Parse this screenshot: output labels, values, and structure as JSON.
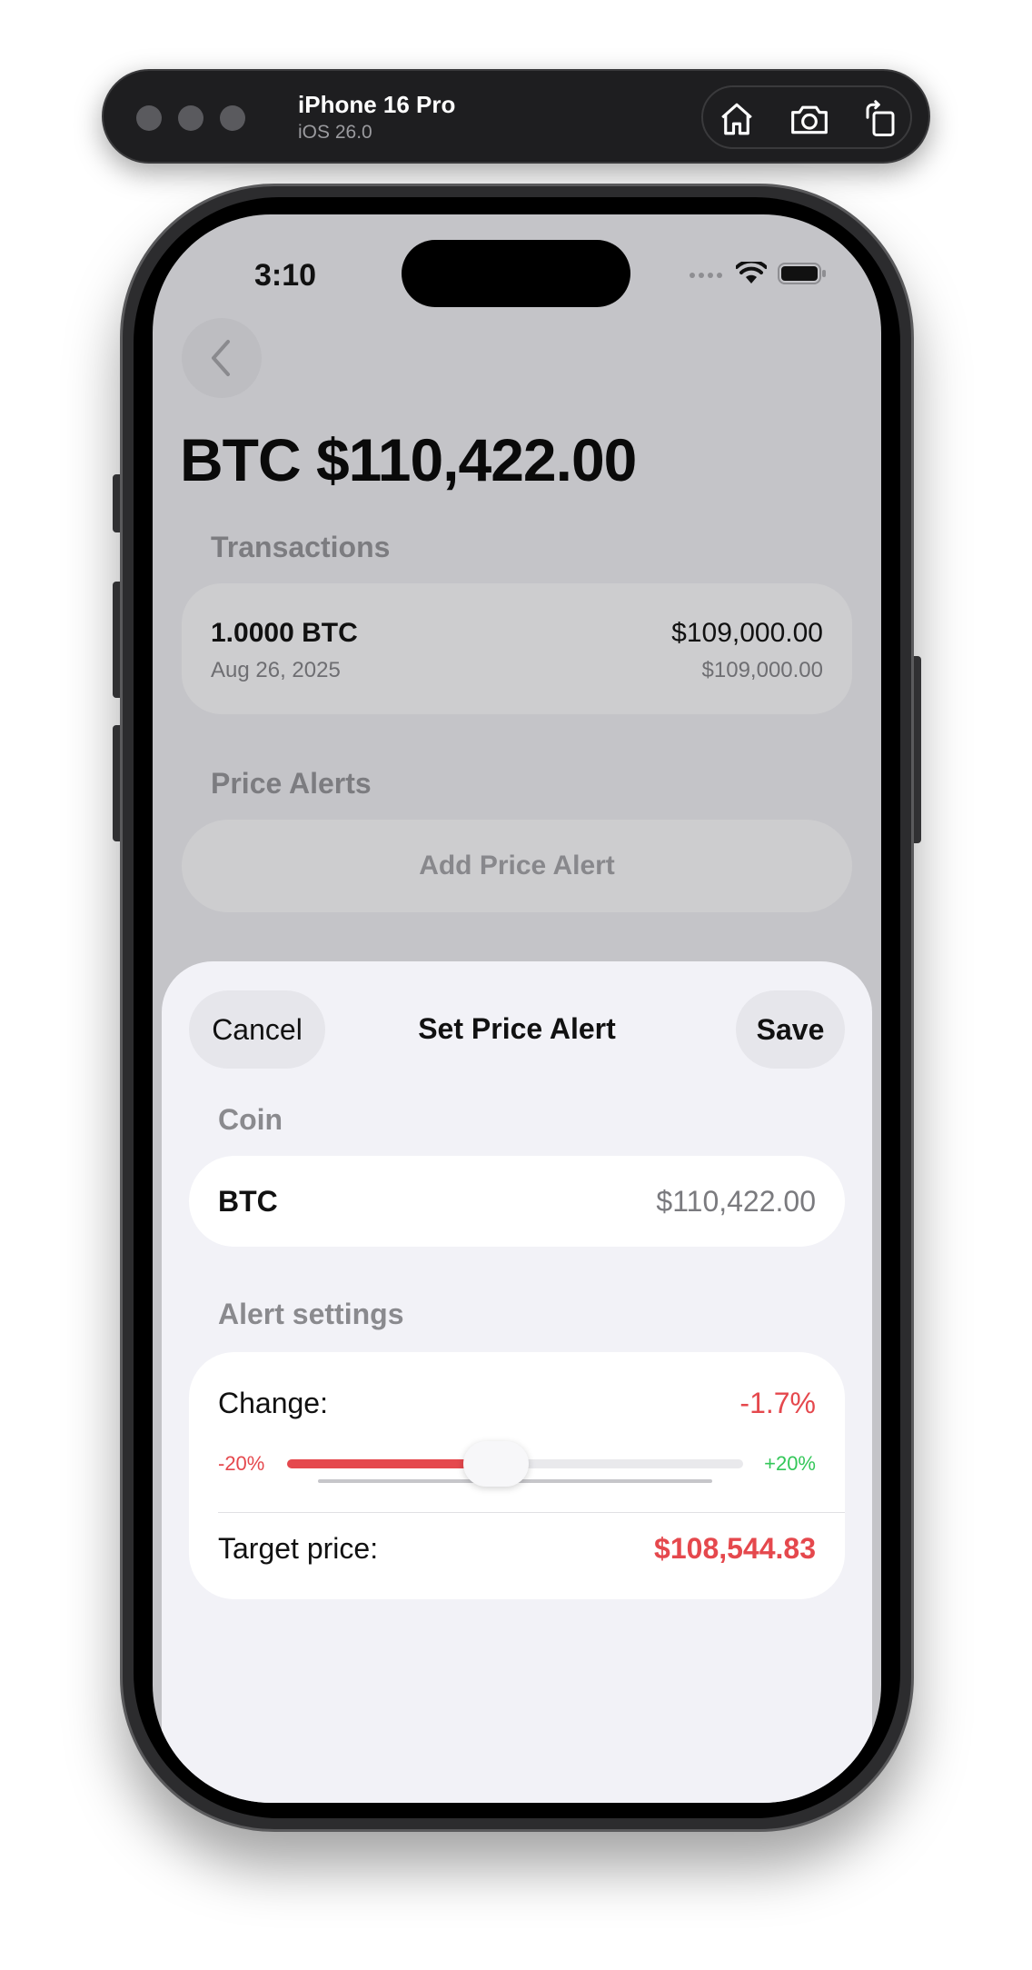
{
  "simulator": {
    "device_name": "iPhone 16 Pro",
    "os_version": "iOS 26.0",
    "icons": [
      "home-icon",
      "screenshot-icon",
      "rotate-icon"
    ]
  },
  "status_bar": {
    "time": "3:10",
    "icons": [
      "cellular-icon",
      "wifi-icon",
      "battery-icon"
    ]
  },
  "header": {
    "back_icon": "chevron-left-icon",
    "title": "BTC $110,422.00"
  },
  "transactions": {
    "label": "Transactions",
    "items": [
      {
        "amount": "1.0000 BTC",
        "date": "Aug 26, 2025",
        "value": "$109,000.00",
        "cost": "$109,000.00"
      }
    ]
  },
  "price_alerts": {
    "label": "Price Alerts",
    "add_button": "Add Price Alert"
  },
  "sheet": {
    "cancel_label": "Cancel",
    "title": "Set Price Alert",
    "save_label": "Save",
    "coin_section_label": "Coin",
    "coin": {
      "symbol": "BTC",
      "price": "$110,422.00"
    },
    "settings_section_label": "Alert settings",
    "change_label": "Change:",
    "change_value": "-1.7%",
    "slider": {
      "min_label": "-20%",
      "max_label": "+20%",
      "min": -20,
      "max": 20,
      "value": -1.7
    },
    "target_label": "Target price:",
    "target_value": "$108,544.83"
  },
  "colors": {
    "negative": "#e5484d",
    "positive": "#34c759",
    "sheet_background": "#f2f2f7",
    "dimmed_background": "#c4c4c8"
  }
}
